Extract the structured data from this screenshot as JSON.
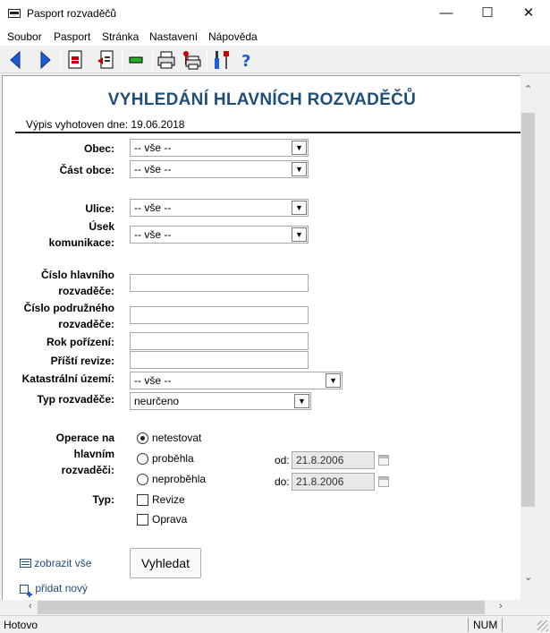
{
  "window": {
    "title": "Pasport rozvaděčů",
    "minimize": "—",
    "maximize": "☐",
    "close": "✕"
  },
  "menu": [
    "Soubor",
    "Pasport",
    "Stránka",
    "Nastavení",
    "Nápověda"
  ],
  "toolbar_icons": [
    "back-arrow-icon",
    "forward-arrow-icon",
    "document-icon",
    "export-icon",
    "green-bar-icon",
    "printer-icon",
    "print-settings-icon",
    "tools-icon",
    "help-icon"
  ],
  "page": {
    "heading": "VYHLEDÁNÍ HLAVNÍCH ROZVADĚČŮ",
    "date_line": "Výpis vyhotoven dne: 19.06.2018"
  },
  "form": {
    "obec": {
      "label": "Obec:",
      "value": "-- vše --"
    },
    "cast_obce": {
      "label": "Část obce:",
      "value": "-- vše --"
    },
    "ulice": {
      "label": "Ulice:",
      "value": "-- vše --"
    },
    "usek": {
      "label_1": "Úsek",
      "label_2": "komunikace:",
      "value": "-- vše --"
    },
    "cislo_hlavniho": {
      "label_1": "Číslo hlavního",
      "label_2": "rozvaděče:",
      "value": ""
    },
    "cislo_podruzneho": {
      "label_1": "Číslo podružného",
      "label_2": "rozvaděče:",
      "value": ""
    },
    "rok_porizeni": {
      "label": "Rok pořízení:",
      "value": ""
    },
    "pristi_revize": {
      "label": "Příští revize:",
      "value": ""
    },
    "katastralni_uzemi": {
      "label": "Katastrální území:",
      "value": "-- vše --"
    },
    "typ_rozvadece": {
      "label": "Typ rozvaděče:",
      "value": "neurčeno"
    },
    "operace": {
      "label_1": "Operace na",
      "label_2": "hlavním",
      "label_3": "rozvaděči:",
      "options": [
        "netestovat",
        "proběhla",
        "neproběhla"
      ],
      "selected": "netestovat"
    },
    "od": {
      "label": "od:",
      "value": "21.8.2006"
    },
    "do": {
      "label": "do:",
      "value": "21.8.2006"
    },
    "typ": {
      "label": "Typ:",
      "options": [
        "Revize",
        "Oprava"
      ]
    }
  },
  "actions": {
    "show_all": "zobrazit vše",
    "search": "Vyhledat",
    "add_new": "přidat nový"
  },
  "status": {
    "text": "Hotovo",
    "num": "NUM"
  }
}
